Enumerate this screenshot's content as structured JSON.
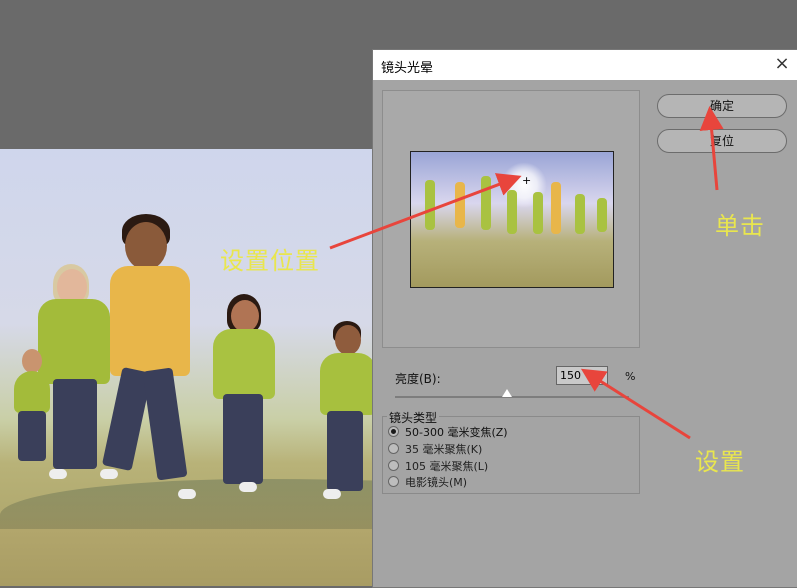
{
  "dialog": {
    "title": "镜头光晕",
    "close_icon": "×",
    "ok_label": "确定",
    "reset_label": "复位",
    "brightness_label": "亮度(B):",
    "brightness_value": "150",
    "brightness_unit": "%",
    "lens_group_label": "镜头类型",
    "lens_options": [
      {
        "label": "50-300 毫米变焦(Z)",
        "selected": true
      },
      {
        "label": "35 毫米聚焦(K)",
        "selected": false
      },
      {
        "label": "105 毫米聚焦(L)",
        "selected": false
      },
      {
        "label": "电影镜头(M)",
        "selected": false
      }
    ],
    "flare_center_marker": "+"
  },
  "annotations": {
    "set_position": "设置位置",
    "click": "单击",
    "set": "设置",
    "arrow_color": "#e8453c",
    "text_color": "#e9e64e"
  }
}
